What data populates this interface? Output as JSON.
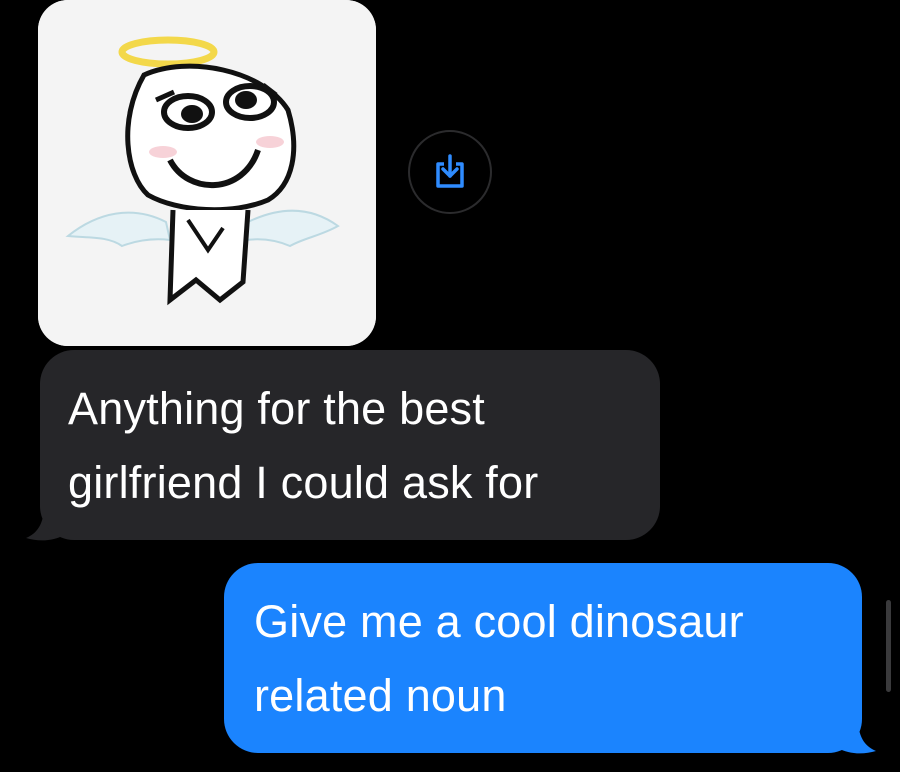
{
  "conversation": {
    "attachment": {
      "type": "image",
      "description_icon": "angel-meme-image"
    },
    "save_button": {
      "icon": "download-icon"
    },
    "messages": [
      {
        "direction": "received",
        "lines": [
          "Anything for the best",
          "girlfriend I could ask for"
        ]
      },
      {
        "direction": "sent",
        "lines": [
          "Give me a cool dinosaur",
          "related noun"
        ]
      }
    ]
  },
  "colors": {
    "background": "#000000",
    "received_bubble": "#262629",
    "sent_bubble": "#1b84fe",
    "text": "#ffffff",
    "accent_icon": "#2f8cff"
  }
}
